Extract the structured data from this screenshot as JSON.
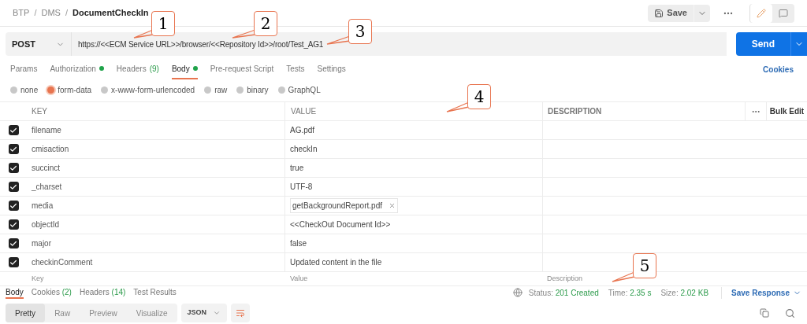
{
  "breadcrumb": [
    {
      "label": "BTP",
      "current": false
    },
    {
      "label": "DMS",
      "current": false
    },
    {
      "label": "DocumentCheckIn",
      "current": true
    }
  ],
  "breadcrumb_separator": "/",
  "toolbar": {
    "save": "Save"
  },
  "request": {
    "method": "POST",
    "url": "https://<<ECM Service URL>>/browser/<<Repository Id>>/root/Test_AG1",
    "send": "Send"
  },
  "tabs": [
    {
      "label": "Params",
      "selected": false,
      "dot": false
    },
    {
      "label": "Authorization",
      "selected": false,
      "dot": true
    },
    {
      "label": "Headers",
      "count": "(9)",
      "selected": false,
      "dot": false
    },
    {
      "label": "Body",
      "selected": true,
      "dot": true
    },
    {
      "label": "Pre-request Script",
      "selected": false,
      "dot": false
    },
    {
      "label": "Tests",
      "selected": false,
      "dot": false
    },
    {
      "label": "Settings",
      "selected": false,
      "dot": false
    }
  ],
  "cookies_link": "Cookies",
  "body_types": [
    {
      "label": "none",
      "selected": false
    },
    {
      "label": "form-data",
      "selected": true
    },
    {
      "label": "x-www-form-urlencoded",
      "selected": false
    },
    {
      "label": "raw",
      "selected": false
    },
    {
      "label": "binary",
      "selected": false
    },
    {
      "label": "GraphQL",
      "selected": false
    }
  ],
  "table": {
    "columns": [
      "KEY",
      "VALUE",
      "DESCRIPTION"
    ],
    "bulk_edit": "Bulk Edit",
    "rows": [
      {
        "key": "filename",
        "value": "AG.pdf",
        "kind": "text",
        "checked": true
      },
      {
        "key": "cmisaction",
        "value": "checkIn",
        "kind": "text",
        "checked": true
      },
      {
        "key": "succinct",
        "value": "true",
        "kind": "text",
        "checked": true
      },
      {
        "key": "_charset",
        "value": "UTF-8",
        "kind": "text",
        "checked": true
      },
      {
        "key": "media",
        "value": "getBackgroundReport.pdf",
        "kind": "file",
        "checked": true
      },
      {
        "key": "objectId",
        "value": "<<CheckOut Document Id>>",
        "kind": "text",
        "checked": true
      },
      {
        "key": "major",
        "value": "false",
        "kind": "text",
        "checked": true
      },
      {
        "key": "checkinComment",
        "value": "Updated content in the file",
        "kind": "text",
        "checked": true
      }
    ],
    "new_row": {
      "key_placeholder": "Key",
      "value_placeholder": "Value",
      "description_placeholder": "Description"
    }
  },
  "response": {
    "tabs": [
      {
        "label": "Body",
        "selected": true
      },
      {
        "label": "Cookies",
        "count": "(2)",
        "selected": false
      },
      {
        "label": "Headers",
        "count": "(14)",
        "selected": false
      },
      {
        "label": "Test Results",
        "selected": false
      }
    ],
    "status_label": "Status:",
    "status": "201 Created",
    "time_label": "Time:",
    "time": "2.35 s",
    "size_label": "Size:",
    "size": "2.02 KB",
    "save_response": "Save Response",
    "views": [
      {
        "label": "Pretty",
        "selected": true
      },
      {
        "label": "Raw",
        "selected": false
      },
      {
        "label": "Preview",
        "selected": false
      },
      {
        "label": "Visualize",
        "selected": false
      }
    ],
    "format": "JSON"
  },
  "callouts": [
    "1",
    "2",
    "3",
    "4",
    "5"
  ]
}
